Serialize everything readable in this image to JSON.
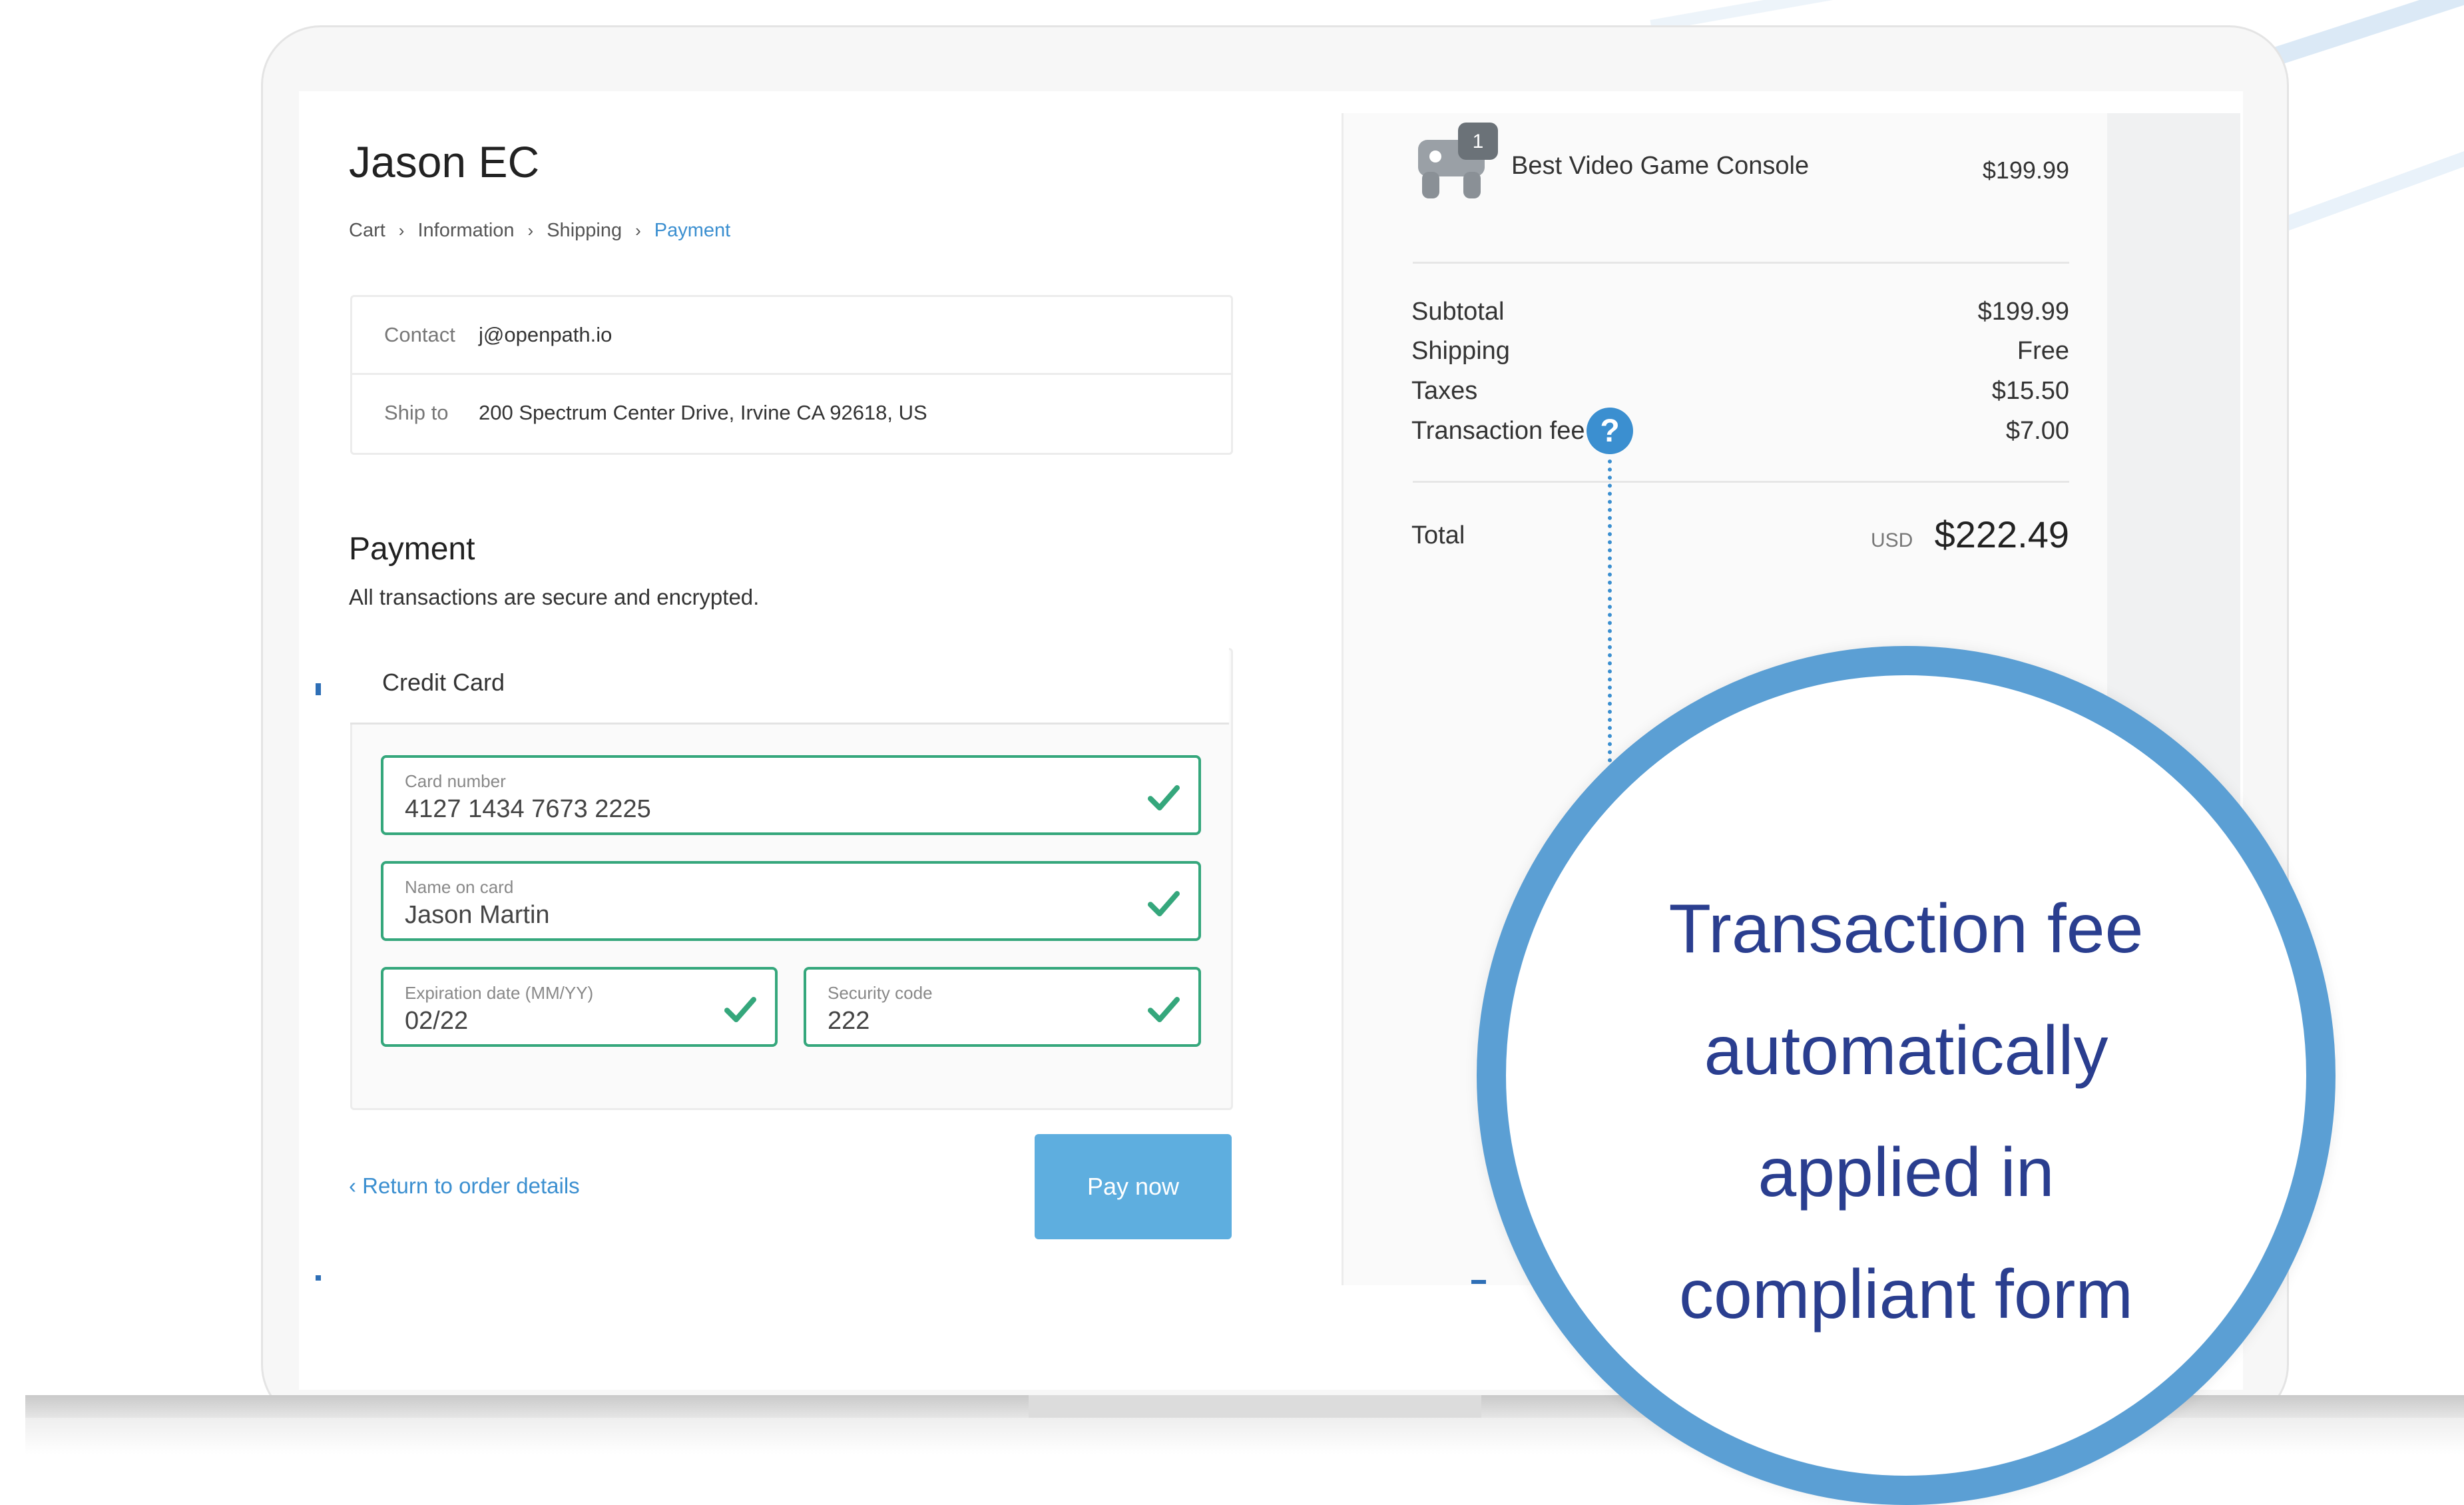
{
  "checkout": {
    "store_name": "Jason EC",
    "breadcrumb": [
      {
        "label": "Cart",
        "active": false
      },
      {
        "label": "Information",
        "active": false
      },
      {
        "label": "Shipping",
        "active": false
      },
      {
        "label": "Payment",
        "active": true
      }
    ],
    "breadcrumb_separator": "›",
    "contact": {
      "label": "Contact",
      "value": "j@openpath.io"
    },
    "ship_to": {
      "label": "Ship to",
      "value": "200 Spectrum Center Drive, Irvine CA 92618, US"
    },
    "payment_heading": "Payment",
    "payment_subtext": "All transactions are secure and encrypted.",
    "payment_method": "Credit Card",
    "fields": {
      "card_number": {
        "label": "Card number",
        "value": "4127 1434 7673 2225"
      },
      "name_on_card": {
        "label": "Name on card",
        "value": "Jason Martin"
      },
      "expiration": {
        "label": "Expiration date (MM/YY)",
        "value": "02/22"
      },
      "security_code": {
        "label": "Security code",
        "value": "222"
      }
    },
    "return_link": "‹ Return to order details",
    "pay_button": "Pay now"
  },
  "order_summary": {
    "product": {
      "name": "Best Video Game Console",
      "price": "$199.99",
      "quantity": "1",
      "icon": "game-console-icon"
    },
    "lines": [
      {
        "label": "Subtotal",
        "value": "$199.99"
      },
      {
        "label": "Shipping",
        "value": "Free"
      },
      {
        "label": "Taxes",
        "value": "$15.50"
      },
      {
        "label": "Transaction fee",
        "value": "$7.00"
      }
    ],
    "help_icon": "?",
    "total_label": "Total",
    "total_currency": "USD",
    "total_value": "$222.49"
  },
  "callout": {
    "lines": [
      "Transaction fee",
      "automatically",
      "applied in",
      "compliant form"
    ]
  },
  "colors": {
    "accent": "#3b8fd0",
    "valid_border": "#35a77c",
    "button": "#5eaedf",
    "callout_ring": "#5b9fd4",
    "callout_text": "#2a3e8f"
  }
}
